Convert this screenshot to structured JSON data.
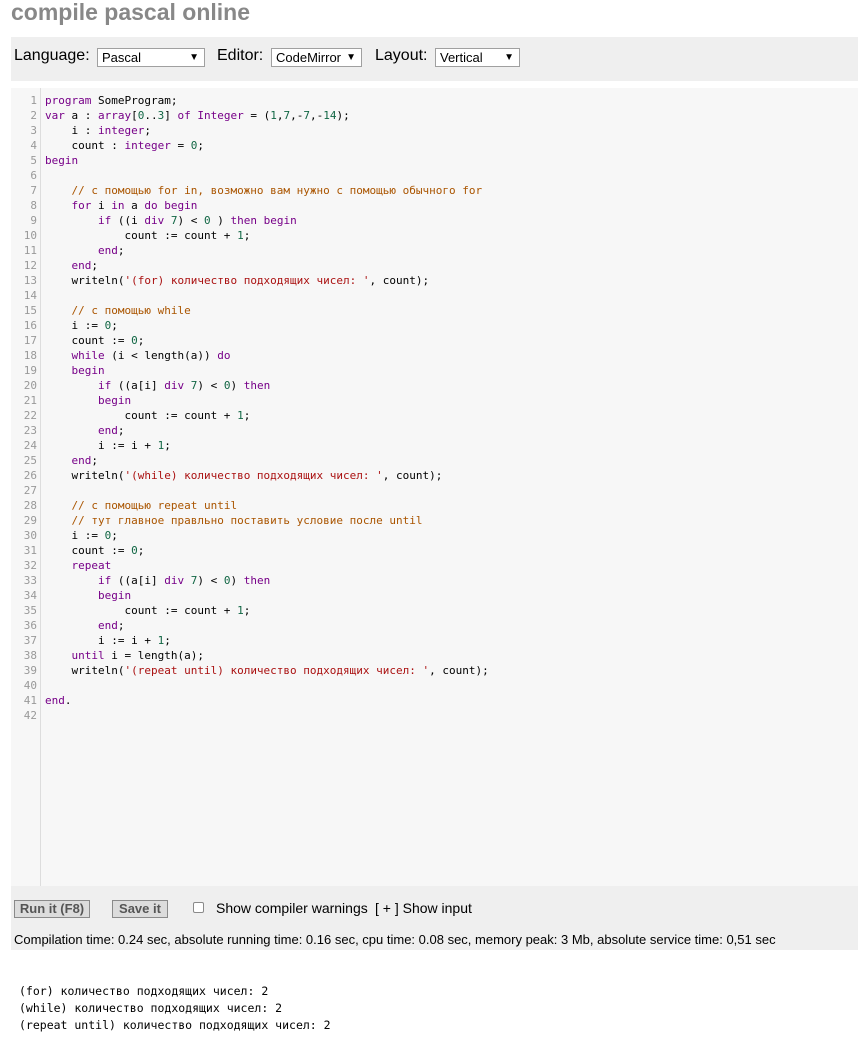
{
  "page": {
    "title": "compile pascal online"
  },
  "toolbar": {
    "language_label": "Language:",
    "language_value": "Pascal",
    "editor_label": "Editor:",
    "editor_value": "CodeMirror",
    "layout_label": "Layout:",
    "layout_value": "Vertical"
  },
  "editor": {
    "lines": [
      "program SomeProgram;",
      "var a : array[0..3] of Integer = (1,7,-7,-14);",
      "    i : integer;",
      "    count : integer = 0;",
      "begin",
      "",
      "    // с помощью for in, возможно вам нужно с помощью обычного for",
      "    for i in a do begin",
      "        if ((i div 7) < 0 ) then begin",
      "            count := count + 1;",
      "        end;",
      "    end;",
      "    writeln('(for) количество подходящих чисел: ', count);",
      "",
      "    // с помощью while",
      "    i := 0;",
      "    count := 0;",
      "    while (i < length(a)) do",
      "    begin",
      "        if ((a[i] div 7) < 0) then",
      "        begin",
      "            count := count + 1;",
      "        end;",
      "        i := i + 1;",
      "    end;",
      "    writeln('(while) количество подходящих чисел: ', count);",
      "",
      "    // с помощью repeat until",
      "    // тут главное правльно поставить условие после until",
      "    i := 0;",
      "    count := 0;",
      "    repeat",
      "        if ((a[i] div 7) < 0) then",
      "        begin",
      "            count := count + 1;",
      "        end;",
      "        i := i + 1;",
      "    until i = length(a);",
      "    writeln('(repeat until) количество подходящих чисел: ', count);",
      "",
      "end.",
      ""
    ]
  },
  "run_bar": {
    "run_label": "Run it (F8)",
    "save_label": "Save it",
    "warnings_label": "Show compiler warnings",
    "show_input_label": "[ + ] Show input",
    "stats": "Compilation time: 0.24 sec, absolute running time: 0.16 sec, cpu time: 0.08 sec, memory peak: 3 Mb, absolute service time: 0,51 sec"
  },
  "output": {
    "lines": [
      "(for) количество подходящих чисел: 2",
      "(while) количество подходящих чисел: 2",
      "(repeat until) количество подходящих чисел: 2"
    ]
  },
  "colors": {
    "keyword": "#770088",
    "number": "#116644",
    "string": "#aa1111",
    "comment": "#aa5500",
    "title": "#888888"
  }
}
